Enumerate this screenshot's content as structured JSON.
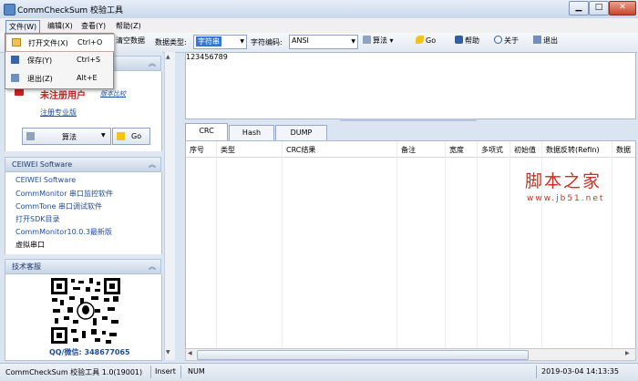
{
  "window": {
    "title": "CommCheckSum 校验工具"
  },
  "menu": {
    "items": [
      {
        "label": "文件(W)"
      },
      {
        "label": "编辑(X)"
      },
      {
        "label": "查看(Y)"
      },
      {
        "label": "帮助(Z)"
      }
    ]
  },
  "file_menu": {
    "items": [
      {
        "label": "打开文件(X)",
        "shortcut": "Ctrl+O"
      },
      {
        "label": "保存(Y)",
        "shortcut": "Ctrl+S"
      },
      {
        "label": "退出(Z)",
        "shortcut": "Alt+E"
      }
    ]
  },
  "toolbar": {
    "clear_label": "清空数据",
    "data_type_label": "数据类型:",
    "data_type_value": "字符串",
    "encoding_label": "字符编码:",
    "encoding_value": "ANSI",
    "algo_label": "算法",
    "go_label": "Go",
    "help_label": "帮助",
    "about_label": "关于",
    "exit_label": "退出"
  },
  "left": {
    "register": {
      "status": "未注册用户",
      "version_link": "版本比较",
      "register_link": "注册专业版",
      "algo_button": "算法",
      "go_button": "Go"
    },
    "ceiwei": {
      "header": "CEIWEI Software",
      "links": [
        "CEIWEI Software",
        "CommMonitor 串口监控软件",
        "CommTone 串口调试软件",
        "打开SDK目录",
        "CommMonitor10.0.3最新版",
        "虚拟串口"
      ]
    },
    "support": {
      "header": "技术客服",
      "contact": "QQ/微信: 348677065"
    }
  },
  "editor": {
    "content": "123456789"
  },
  "tabs": [
    {
      "label": "CRC"
    },
    {
      "label": "Hash"
    },
    {
      "label": "DUMP"
    }
  ],
  "grid": {
    "columns": [
      "序号",
      "类型",
      "CRC结果",
      "备注",
      "宽度",
      "多项式",
      "初始值",
      "数据反转(RefIn)",
      "数据"
    ]
  },
  "status": {
    "app": "CommCheckSum 校验工具 1.0(19001)",
    "mode": "Insert",
    "num": "NUM",
    "datetime": "2019-03-04 14:13:35"
  },
  "watermark": {
    "text": "脚本之家",
    "url": "www.jb51.net"
  },
  "colors": {
    "accent": "#3375d6",
    "link": "#1d4fa0",
    "unregistered": "#c81e1e",
    "watermark": "#d12c20"
  }
}
